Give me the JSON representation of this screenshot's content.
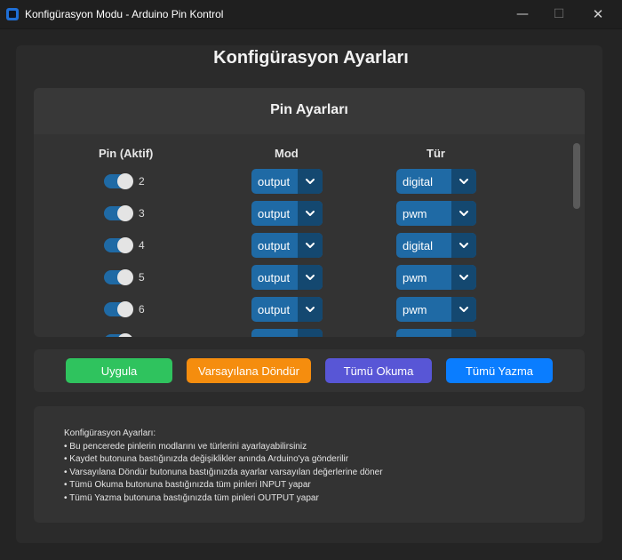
{
  "window": {
    "title": "Konfigürasyon Modu - Arduino Pin Kontrol",
    "minimize_glyph": "—",
    "maximize_glyph": "☐",
    "close_glyph": "✕"
  },
  "main_title": "Konfigürasyon Ayarları",
  "pin_panel": {
    "title": "Pin Ayarları",
    "columns": {
      "pin": "Pin (Aktif)",
      "mode": "Mod",
      "type": "Tür"
    },
    "rows": [
      {
        "pin": "2",
        "active": true,
        "mode": "output",
        "type": "digital"
      },
      {
        "pin": "3",
        "active": true,
        "mode": "output",
        "type": "pwm"
      },
      {
        "pin": "4",
        "active": true,
        "mode": "output",
        "type": "digital"
      },
      {
        "pin": "5",
        "active": true,
        "mode": "output",
        "type": "pwm"
      },
      {
        "pin": "6",
        "active": true,
        "mode": "output",
        "type": "pwm"
      },
      {
        "pin": "",
        "active": true,
        "mode": "",
        "type": ""
      }
    ]
  },
  "buttons": {
    "apply": "Uygula",
    "reset": "Varsayılana Döndür",
    "read_all": "Tümü Okuma",
    "write_all": "Tümü Yazma"
  },
  "info_lines": [
    "Konfigürasyon Ayarları:",
    "• Bu pencerede pinlerin modlarını ve türlerini ayarlayabilirsiniz",
    "• Kaydet butonuna bastığınızda değişiklikler anında Arduino'ya gönderilir",
    "• Varsayılana Döndür butonuna bastığınızda ayarlar varsayılan değerlerine döner",
    "• Tümü Okuma butonuna bastığınızda tüm pinleri INPUT yapar",
    "• Tümü Yazma butonuna bastığınızda tüm pinleri OUTPUT yapar"
  ],
  "colors": {
    "apply": "#2fc35e",
    "reset": "#f58d0e",
    "read_all": "#5856d6",
    "write_all": "#0a7dff",
    "accent": "#1f6aa5"
  },
  "icons": {
    "dropdown": "chevron-down-icon",
    "app": "app-icon"
  }
}
